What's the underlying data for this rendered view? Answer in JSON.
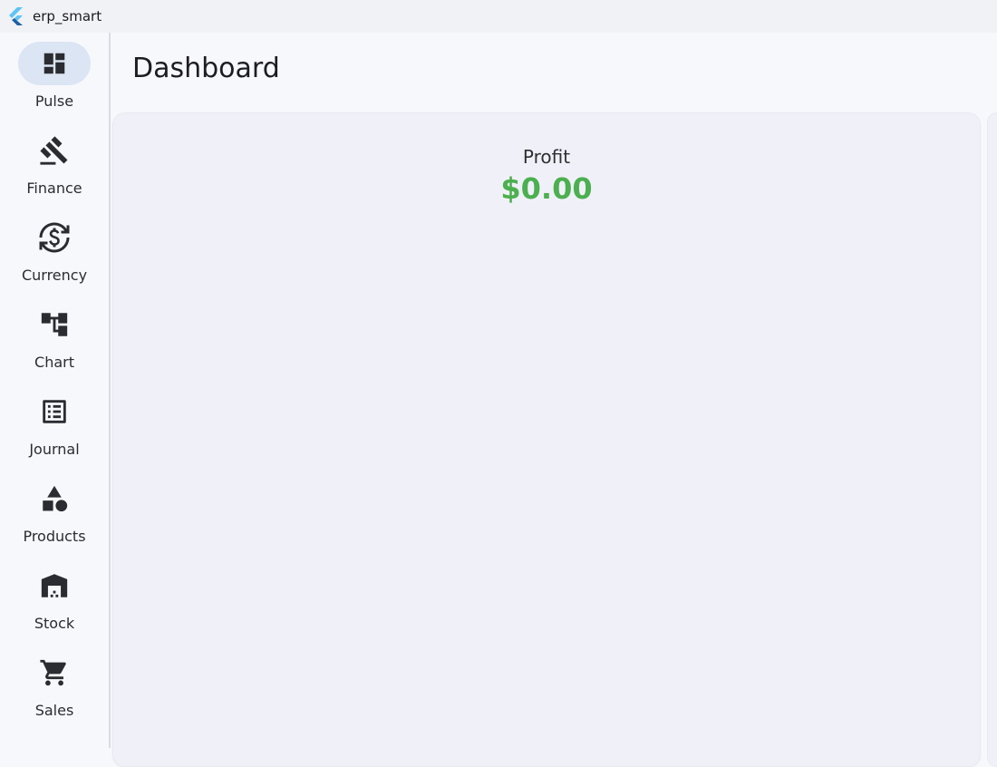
{
  "window": {
    "title": "erp_smart",
    "logo_icon": "flutter-logo-icon"
  },
  "nav": {
    "selected_index": 0,
    "selected_color": "#dbe5f3",
    "items": [
      {
        "label": "Pulse",
        "icon": "dashboard-icon"
      },
      {
        "label": "Finance",
        "icon": "gavel-icon"
      },
      {
        "label": "Currency",
        "icon": "currency-exchange-icon"
      },
      {
        "label": "Chart",
        "icon": "account-tree-icon"
      },
      {
        "label": "Journal",
        "icon": "list-alt-icon"
      },
      {
        "label": "Products",
        "icon": "category-icon"
      },
      {
        "label": "Stock",
        "icon": "warehouse-icon"
      },
      {
        "label": "Sales",
        "icon": "shopping-cart-icon"
      }
    ]
  },
  "page": {
    "title": "Dashboard"
  },
  "profit": {
    "label": "Profit",
    "value": "$0.00",
    "value_color": "#4caf50"
  }
}
